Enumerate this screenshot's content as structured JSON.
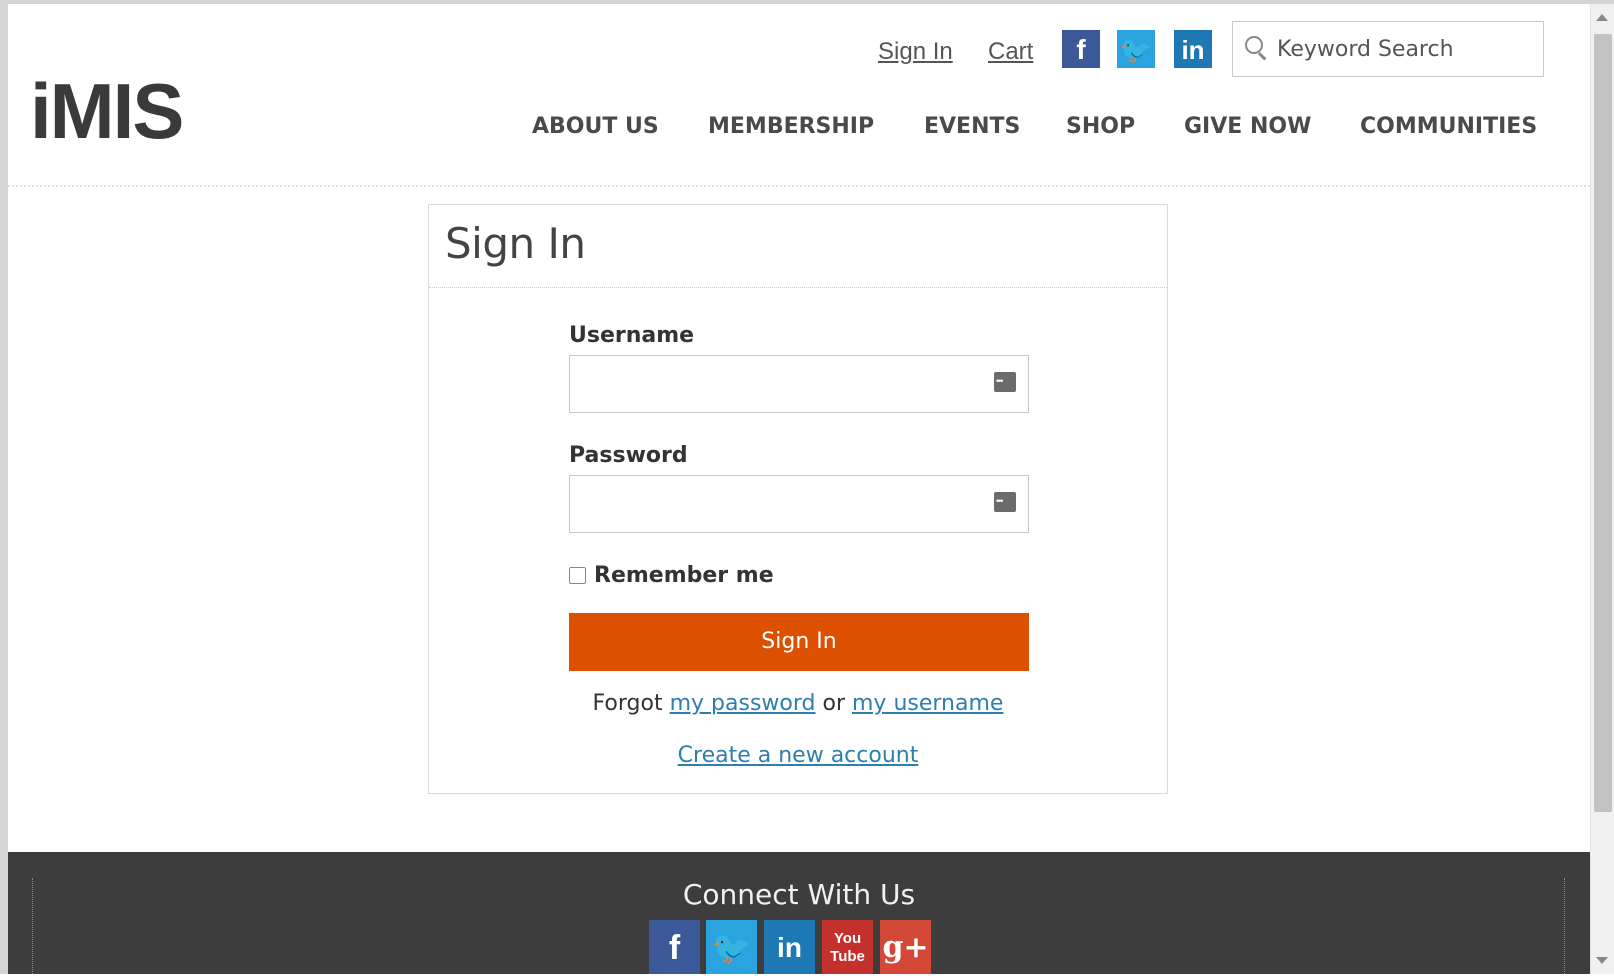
{
  "header": {
    "logo_text": "iMIS",
    "sign_in_link": "Sign In",
    "cart_link": "Cart",
    "social": [
      {
        "name": "facebook-icon",
        "glyph": "f"
      },
      {
        "name": "twitter-icon",
        "glyph": "🐦"
      },
      {
        "name": "linkedin-icon",
        "glyph": "in"
      }
    ],
    "search_placeholder": "Keyword Search"
  },
  "nav": {
    "items": [
      {
        "label": "ABOUT US"
      },
      {
        "label": "MEMBERSHIP"
      },
      {
        "label": "EVENTS"
      },
      {
        "label": "SHOP"
      },
      {
        "label": "GIVE NOW"
      },
      {
        "label": "COMMUNITIES"
      }
    ]
  },
  "signin": {
    "title": "Sign In",
    "username_label": "Username",
    "username_value": "",
    "password_label": "Password",
    "password_value": "",
    "remember_label": "Remember me",
    "remember_checked": false,
    "submit_label": "Sign In",
    "forgot_prefix": "Forgot",
    "forgot_password_link": "my password",
    "forgot_or": "or",
    "forgot_username_link": "my username",
    "create_account_link": "Create a new account"
  },
  "footer": {
    "title": "Connect With Us",
    "social": [
      {
        "name": "facebook",
        "glyph": "f"
      },
      {
        "name": "twitter",
        "glyph": "🐦"
      },
      {
        "name": "linkedin",
        "glyph": "in"
      },
      {
        "name": "youtube",
        "glyph": "You Tube"
      },
      {
        "name": "google-plus",
        "glyph": "g+"
      }
    ]
  },
  "colors": {
    "accent": "#dc5000",
    "link": "#2d7fae",
    "footer_bg": "#3d3d3d"
  }
}
